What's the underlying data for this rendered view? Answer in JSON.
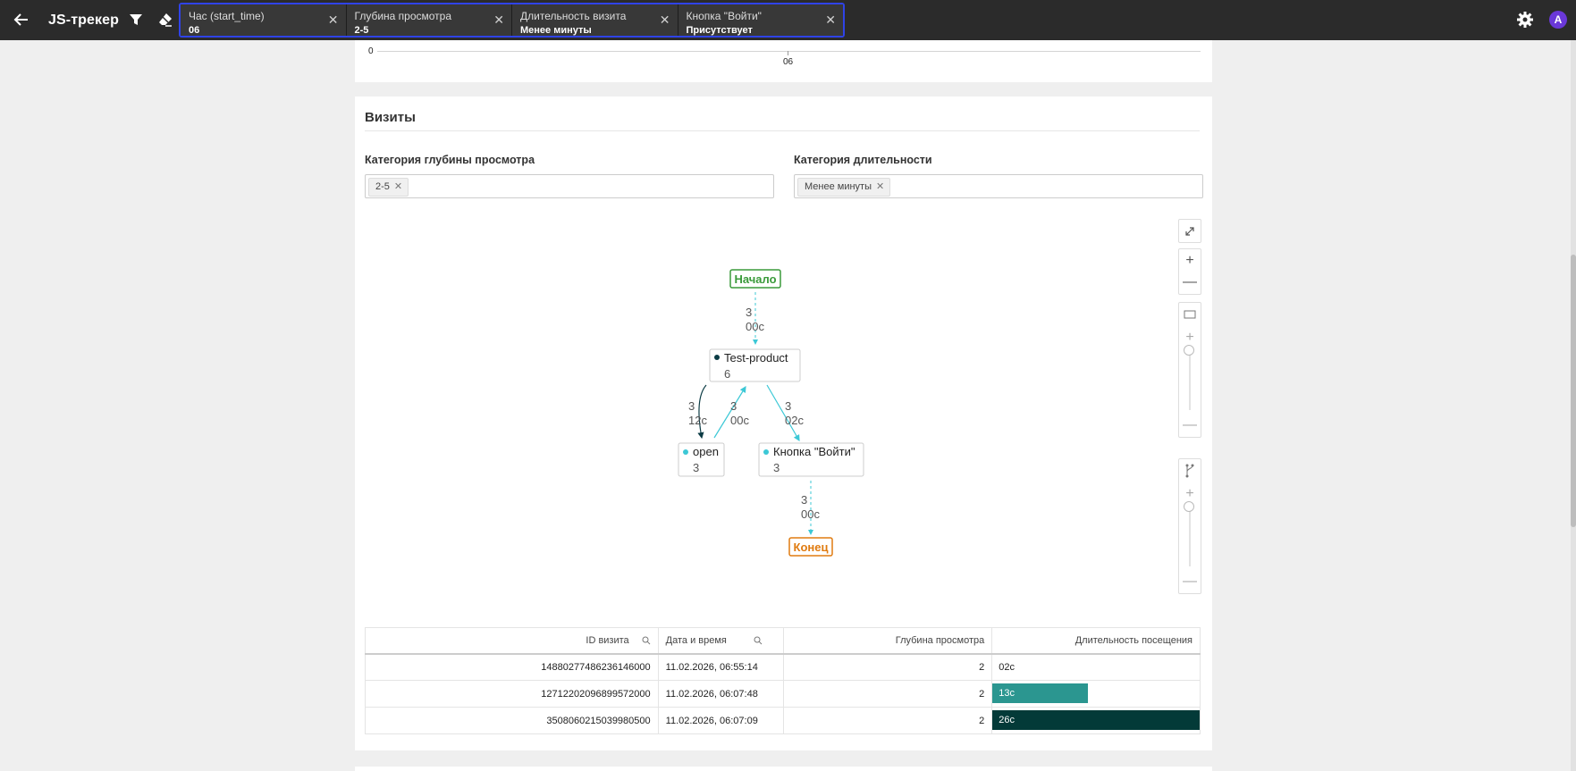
{
  "app": {
    "title": "JS-трекер"
  },
  "filters": [
    {
      "name": "Час (start_time)",
      "value": "06"
    },
    {
      "name": "Глубина просмотра",
      "value": "2-5"
    },
    {
      "name": "Длительность визита",
      "value": "Менее минуты"
    },
    {
      "name": "Кнопка \"Войти\"",
      "value": "Присутствует"
    }
  ],
  "user": {
    "avatar_letter": "A",
    "avatar_color": "#6a38d8"
  },
  "top_chart": {
    "y_tick": "0",
    "x_tick": "06"
  },
  "visits": {
    "title": "Визиты",
    "depth_filter": {
      "label": "Категория глубины просмотра",
      "tag": "2-5"
    },
    "duration_filter": {
      "label": "Категория длительности",
      "tag": "Менее минуты"
    }
  },
  "graph": {
    "nodes": {
      "start": {
        "label": "Начало"
      },
      "product": {
        "label": "Test-product",
        "count": "6"
      },
      "open": {
        "label": "open",
        "count": "3"
      },
      "login": {
        "label": "Кнопка \"Войти\"",
        "count": "3"
      },
      "end": {
        "label": "Конец"
      }
    },
    "edges": {
      "start_product": {
        "count": "3",
        "time": "00с"
      },
      "product_open": {
        "count": "3",
        "time": "12с"
      },
      "open_product": {
        "count": "3",
        "time": "00с"
      },
      "product_login": {
        "count": "3",
        "time": "02с"
      },
      "login_end": {
        "count": "3",
        "time": "00с"
      }
    },
    "colors": {
      "start": "#3a9a3a",
      "end": "#e07b10",
      "edge": "#3cc8d6",
      "dark": "#0b3b44"
    }
  },
  "table": {
    "headers": {
      "id": "ID визита",
      "datetime": "Дата и время",
      "depth": "Глубина просмотра",
      "duration": "Длительность посещения"
    },
    "rows": [
      {
        "id": "14880277486236146000",
        "datetime": "11.02.2026, 06:55:14",
        "depth": "2",
        "duration": "02с",
        "fill": 0,
        "color": "#ffffff"
      },
      {
        "id": "12712202096899572000",
        "datetime": "11.02.2026, 06:07:48",
        "depth": "2",
        "duration": "13с",
        "fill": 0.46,
        "color": "#2b9690"
      },
      {
        "id": "3508060215039980500",
        "datetime": "11.02.2026, 06:07:09",
        "depth": "2",
        "duration": "26с",
        "fill": 1,
        "color": "#033a38"
      }
    ]
  }
}
